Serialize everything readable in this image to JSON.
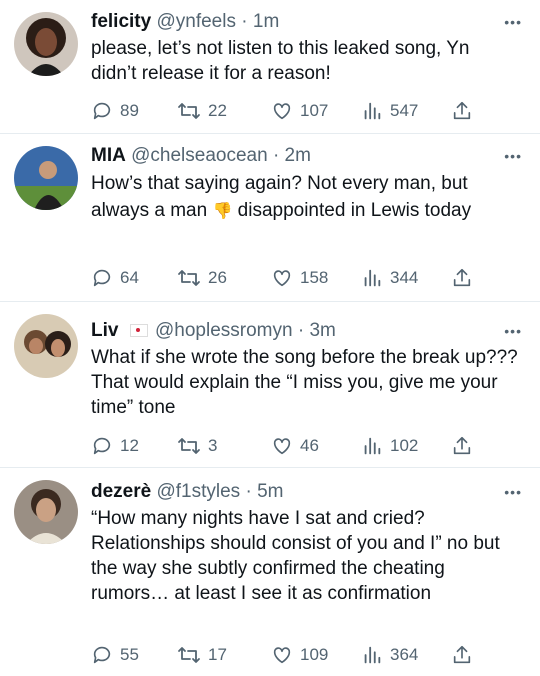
{
  "tweets": [
    {
      "name": "felicity",
      "handle": "@ynfeels",
      "time": "1m",
      "text": "please, let’s not listen to this leaked song, Yn didn’t release it for a reason!",
      "replies": "89",
      "retweets": "22",
      "likes": "107",
      "views": "547"
    },
    {
      "name": "MIA",
      "handle": "@chelseaocean",
      "time": "2m",
      "text_a": "How’s that saying again? Not every man, but",
      "text_b": "always a man",
      "text_c": "disappointed in Lewis today",
      "emoji": "👎",
      "replies": "64",
      "retweets": "26",
      "likes": "158",
      "views": "344"
    },
    {
      "name": "Liv",
      "handle": "@hoplessromyn",
      "time": "3m",
      "text": "What if she wrote the song before the break up??? That would explain the “I miss you, give me your time” tone",
      "replies": "12",
      "retweets": "3",
      "likes": "46",
      "views": "102"
    },
    {
      "name": "dezerè",
      "handle": "@f1styles",
      "time": "5m",
      "text": "“How many nights have I sat and cried? Relationships should consist of you and I” no but the way she subtly confirmed the cheating rumors… at least I see it as confirmation",
      "replies": "55",
      "retweets": "17",
      "likes": "109",
      "views": "364"
    }
  ],
  "ui": {
    "dot": "·",
    "more": "•••"
  },
  "colors": {
    "text": "#0f1419",
    "secondary": "#536471",
    "divider": "#e6ecf0"
  }
}
